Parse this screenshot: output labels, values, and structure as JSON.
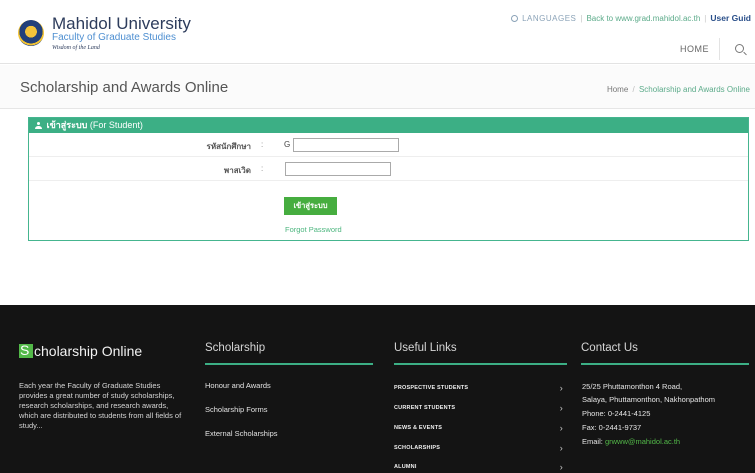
{
  "header": {
    "brand_title": "Mahidol University",
    "brand_subtitle": "Faculty of Graduate Studies",
    "brand_tagline": "Wisdom of the Land",
    "languages_label": "LANGUAGES",
    "back_link": "Back to www.grad.mahidol.ac.th",
    "user_guide": "User Guid",
    "nav_home": "HOME"
  },
  "title_bar": {
    "title": "Scholarship and Awards Online",
    "breadcrumb": [
      "Home",
      "Scholarship and Awards Online"
    ]
  },
  "login": {
    "panel_title_th": "เข้าสู่ระบบ",
    "panel_title_en": "(For Student)",
    "student_id_label": "รหัสนักศึกษา",
    "student_id_prefix": "G",
    "student_id_value": "",
    "password_label": "พาสเวิด",
    "password_value": "",
    "colon": ":",
    "login_button": "เข้าสู่ระบบ",
    "forgot_link": "Forgot Password"
  },
  "footer": {
    "brand_initial": "S",
    "brand_rest": "cholarship Online",
    "description": "Each year the Faculty of Graduate Studies provides a great number of study scholarships, research scholarships, and research awards, which are distributed to students from all fields of study...",
    "scholarship": {
      "title": "Scholarship",
      "items": [
        "Honour and Awards",
        "Scholarship Forms",
        "External Scholarships"
      ]
    },
    "useful_links": {
      "title": "Useful Links",
      "items": [
        "PROSPECTIVE STUDENTS",
        "CURRENT STUDENTS",
        "NEWS & EVENTS",
        "SCHOLARSHIPS",
        "ALUMNI"
      ]
    },
    "contact": {
      "title": "Contact Us",
      "address_1": "25/25 Phuttamonthon 4 Road,",
      "address_2": "Salaya, Phuttamonthon, Nakhonpathom",
      "phone": "Phone: 0-2441-4125",
      "fax": "Fax: 0-2441-9737",
      "email_label": "Email:",
      "email": "grwww@mahidol.ac.th"
    }
  },
  "colors": {
    "accent_green": "#3caf85",
    "button_green": "#46ad3f",
    "footer_bg": "#141414",
    "brand_navy": "#2d3c5c"
  },
  "icons": [
    "university-seal-icon",
    "globe-icon",
    "search-icon",
    "user-icon",
    "chevron-right-icon"
  ]
}
